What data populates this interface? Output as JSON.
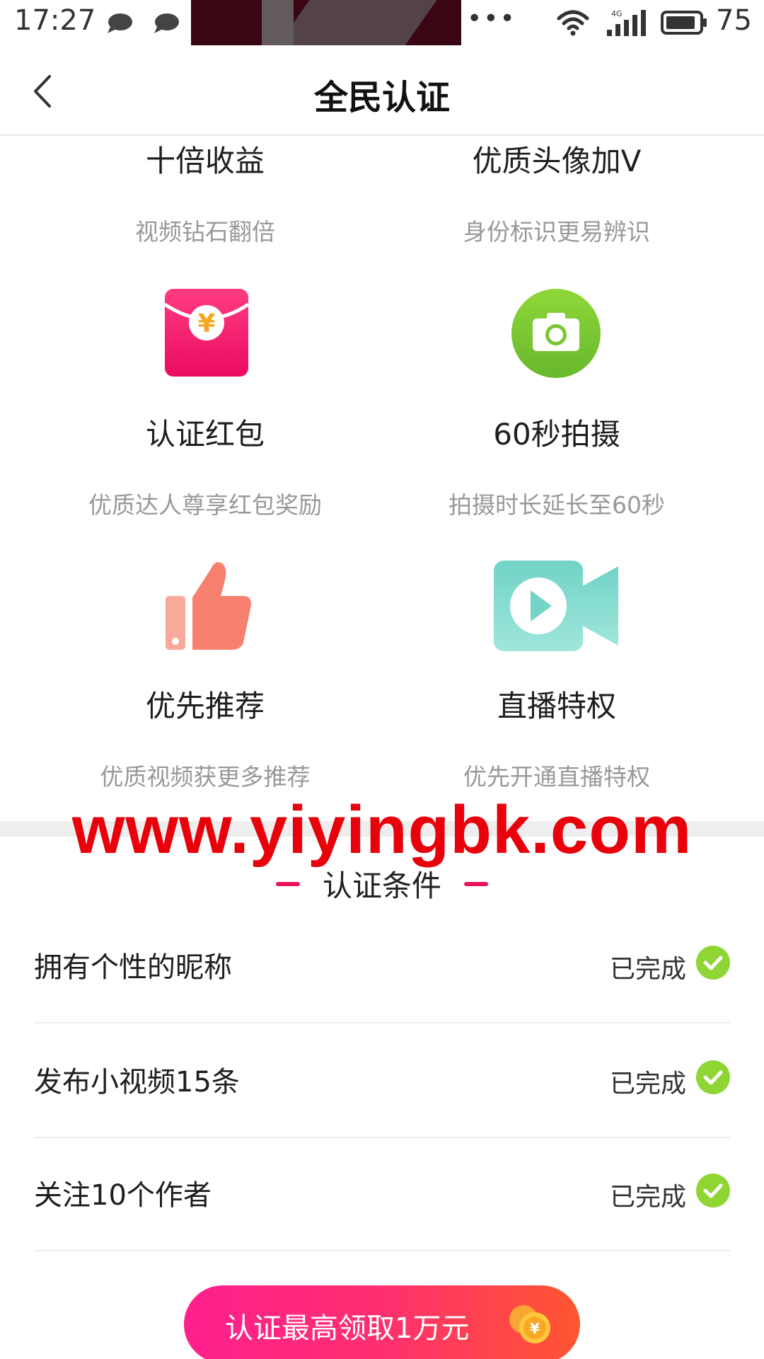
{
  "status_bar": {
    "time": "17:27",
    "more": "•••",
    "network": "4G",
    "battery": "75"
  },
  "header": {
    "title": "全民认证"
  },
  "benefits": [
    {
      "title": "十倍收益",
      "subtitle": "视频钻石翻倍",
      "icon": ""
    },
    {
      "title": "优质头像加V",
      "subtitle": "身份标识更易辨识",
      "icon": ""
    },
    {
      "title": "认证红包",
      "subtitle": "优质达人尊享红包奖励",
      "icon": "red-envelope-icon"
    },
    {
      "title": "60秒拍摄",
      "subtitle": "拍摄时长延长至60秒",
      "icon": "camera-icon"
    },
    {
      "title": "优先推荐",
      "subtitle": "优质视频获更多推荐",
      "icon": "thumbs-up-icon"
    },
    {
      "title": "直播特权",
      "subtitle": "优先开通直播特权",
      "icon": "video-camera-icon"
    }
  ],
  "watermark": "www.yiyingbk.com",
  "requirements": {
    "heading": "认证条件",
    "items": [
      {
        "label": "拥有个性的昵称",
        "status": "已完成"
      },
      {
        "label": "发布小视频15条",
        "status": "已完成"
      },
      {
        "label": "关注10个作者",
        "status": "已完成"
      }
    ]
  },
  "cta": {
    "label": "认证最高领取1万元",
    "coin_symbol": "¥"
  },
  "colors": {
    "accent_pink": "#ff1f8e",
    "accent_orange": "#ff5630",
    "check_green": "#8fd534",
    "watermark_red": "#e8000b",
    "envelope_pink": "#f0156a",
    "camera_green": "#7dc832",
    "thumb_salmon": "#f8806e",
    "video_teal": "#6ed3c6"
  }
}
